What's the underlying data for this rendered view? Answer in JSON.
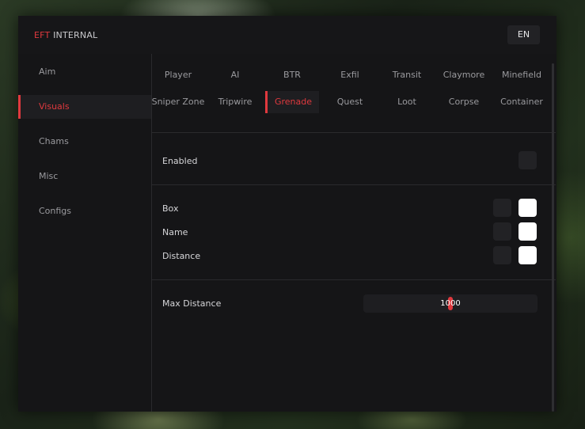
{
  "app": {
    "brand_accent": "EFT",
    "brand_rest": "INTERNAL",
    "language": "EN"
  },
  "sidebar": {
    "items": [
      {
        "label": "Aim",
        "active": false
      },
      {
        "label": "Visuals",
        "active": true
      },
      {
        "label": "Chams",
        "active": false
      },
      {
        "label": "Misc",
        "active": false
      },
      {
        "label": "Configs",
        "active": false
      }
    ]
  },
  "tabs": {
    "row1": [
      "Player",
      "AI",
      "BTR",
      "Exfil",
      "Transit",
      "Claymore",
      "Minefield"
    ],
    "row2": [
      "Sniper Zone",
      "Tripwire",
      "Grenade",
      "Quest",
      "Loot",
      "Corpse",
      "Container"
    ],
    "active": "Grenade"
  },
  "settings": {
    "enabled": {
      "label": "Enabled",
      "checked": false
    },
    "box": {
      "label": "Box",
      "checked": false,
      "color": "#ffffff"
    },
    "name": {
      "label": "Name",
      "checked": false,
      "color": "#ffffff"
    },
    "distance": {
      "label": "Distance",
      "checked": false,
      "color": "#ffffff"
    },
    "max_distance": {
      "label": "Max Distance",
      "value": "1000",
      "fraction": 0.5
    }
  },
  "colors": {
    "accent": "#e0393e",
    "background": "#151517",
    "control": "#222225"
  }
}
